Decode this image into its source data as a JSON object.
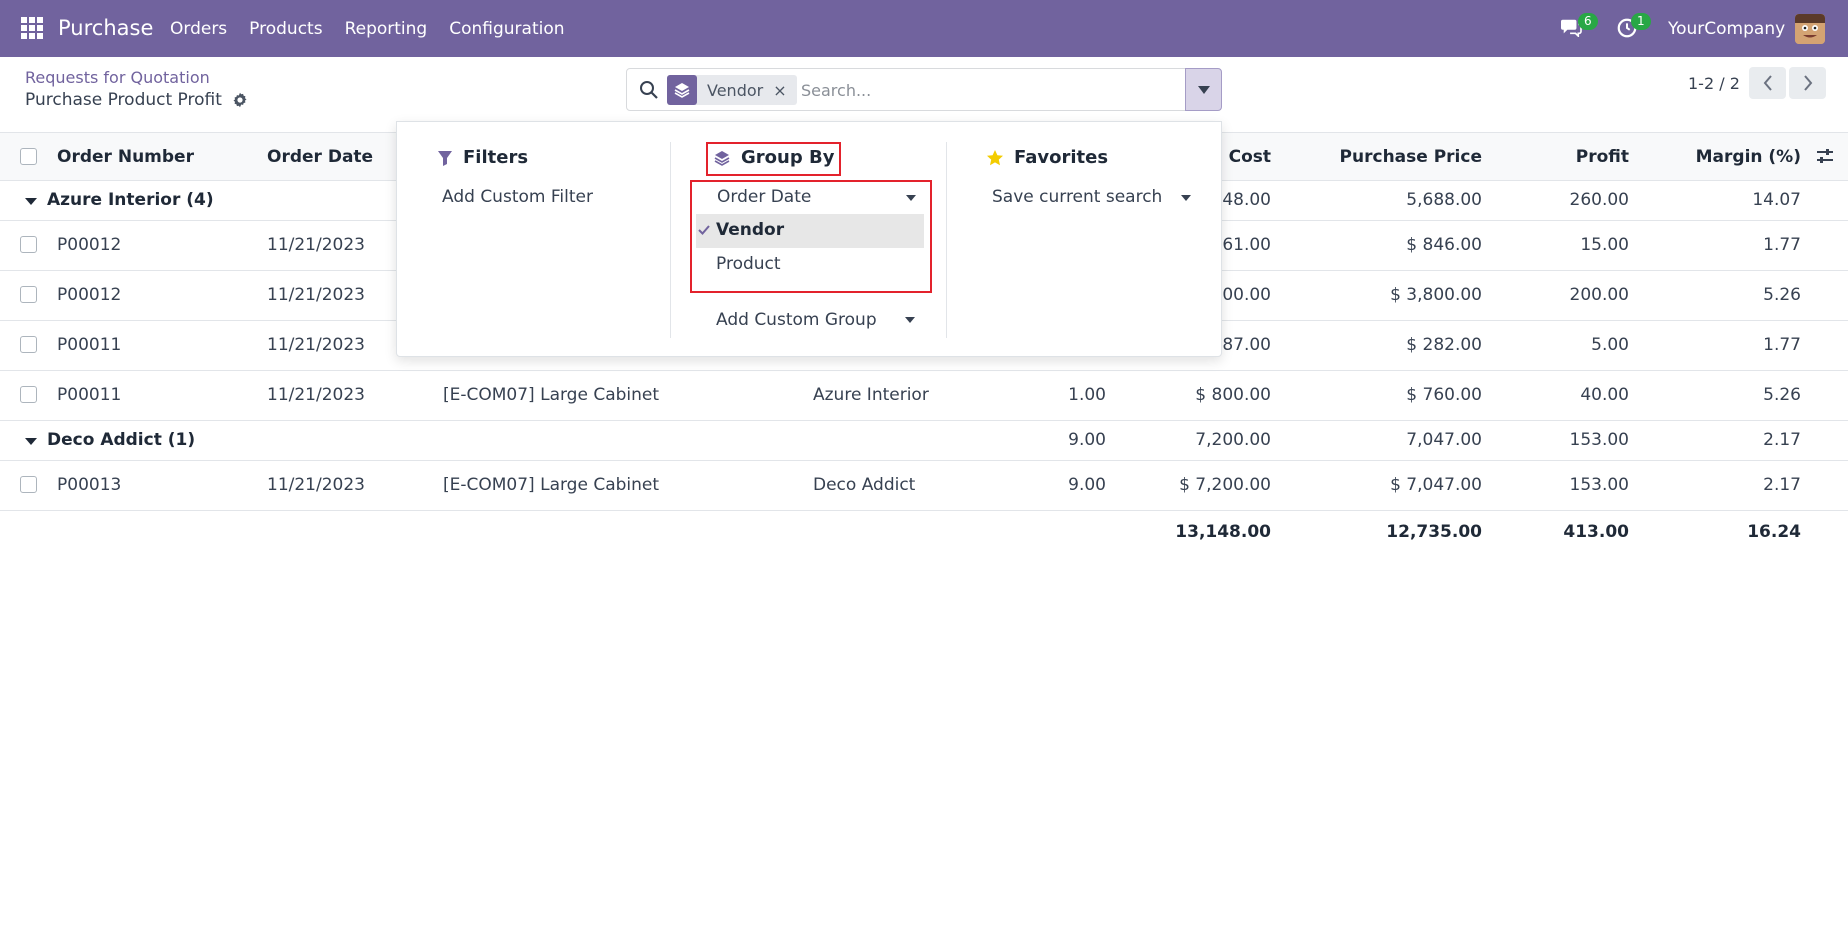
{
  "navbar": {
    "app_name": "Purchase",
    "menu": [
      "Orders",
      "Products",
      "Reporting",
      "Configuration"
    ],
    "messages_count": "6",
    "activities_count": "1",
    "company": "YourCompany"
  },
  "control_panel": {
    "breadcrumb": "Requests for Quotation",
    "title": "Purchase Product Profit",
    "search": {
      "facet_label": "Vendor",
      "facet_remove": "×",
      "placeholder": "Search..."
    },
    "pager": "1-2 / 2"
  },
  "table": {
    "columns": {
      "order_number": "Order Number",
      "order_date": "Order Date",
      "cost": "Cost",
      "purchase_price": "Purchase Price",
      "profit": "Profit",
      "margin": "Margin (%)"
    },
    "groups": [
      {
        "label": "Azure Interior (4)",
        "qty": "",
        "cost": "948.00",
        "purchase_price": "5,688.00",
        "profit": "260.00",
        "margin": "14.07"
      },
      {
        "label": "Deco Addict (1)",
        "qty": "9.00",
        "cost": "7,200.00",
        "purchase_price": "7,047.00",
        "profit": "153.00",
        "margin": "2.17"
      }
    ],
    "rows": [
      {
        "order": "P00012",
        "date": "11/21/2023",
        "product": "",
        "vendor": "",
        "qty": "",
        "cost": "361.00",
        "price": "$ 846.00",
        "profit": "15.00",
        "margin": "1.77"
      },
      {
        "order": "P00012",
        "date": "11/21/2023",
        "product": "",
        "vendor": "",
        "qty": "",
        "cost": "000.00",
        "price": "$ 3,800.00",
        "profit": "200.00",
        "margin": "5.26"
      },
      {
        "order": "P00011",
        "date": "11/21/2023",
        "product": "",
        "vendor": "",
        "qty": "",
        "cost": "287.00",
        "price": "$ 282.00",
        "profit": "5.00",
        "margin": "1.77"
      },
      {
        "order": "P00011",
        "date": "11/21/2023",
        "product": "[E-COM07] Large Cabinet",
        "vendor": "Azure Interior",
        "qty": "1.00",
        "cost": "$ 800.00",
        "price": "$ 760.00",
        "profit": "40.00",
        "margin": "5.26"
      },
      {
        "order": "P00013",
        "date": "11/21/2023",
        "product": "[E-COM07] Large Cabinet",
        "vendor": "Deco Addict",
        "qty": "9.00",
        "cost": "$ 7,200.00",
        "price": "$ 7,047.00",
        "profit": "153.00",
        "margin": "2.17"
      }
    ],
    "totals": {
      "cost": "13,148.00",
      "purchase_price": "12,735.00",
      "profit": "413.00",
      "margin": "16.24"
    }
  },
  "search_panel": {
    "filters": {
      "heading": "Filters",
      "add_custom": "Add Custom Filter"
    },
    "group_by": {
      "heading": "Group By",
      "options": [
        "Order Date",
        "Vendor",
        "Product"
      ],
      "add_custom": "Add Custom Group"
    },
    "favorites": {
      "heading": "Favorites",
      "save_search": "Save current search"
    }
  },
  "colors": {
    "brand": "#71639e",
    "highlight": "#e3222c",
    "badge": "#28a745"
  }
}
